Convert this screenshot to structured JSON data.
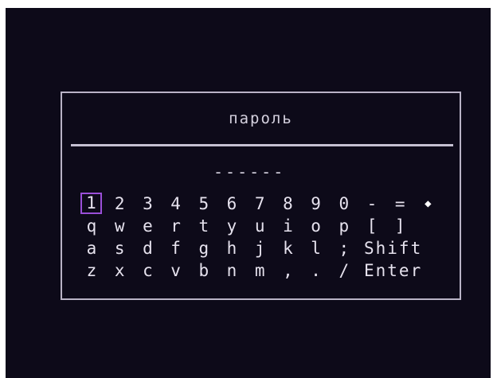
{
  "dialog": {
    "title": "пароль",
    "password_mask": "------"
  },
  "keyboard": {
    "rows": [
      [
        "1",
        "2",
        "3",
        "4",
        "5",
        "6",
        "7",
        "8",
        "9",
        "0",
        "-",
        "=",
        "◆"
      ],
      [
        "q",
        "w",
        "e",
        "r",
        "t",
        "y",
        "u",
        "i",
        "o",
        "p",
        "[",
        "]"
      ],
      [
        "a",
        "s",
        "d",
        "f",
        "g",
        "h",
        "j",
        "k",
        "l",
        ";",
        "Shift"
      ],
      [
        "z",
        "x",
        "c",
        "v",
        "b",
        "n",
        "m",
        ",",
        ".",
        "/",
        "Enter"
      ]
    ],
    "selected_key": "1",
    "backspace_icon": "backspace-icon"
  },
  "colors": {
    "background": "#0d0a19",
    "text": "#e6e2ee",
    "border": "#b9b3c6",
    "selection": "#9a4fd8"
  }
}
